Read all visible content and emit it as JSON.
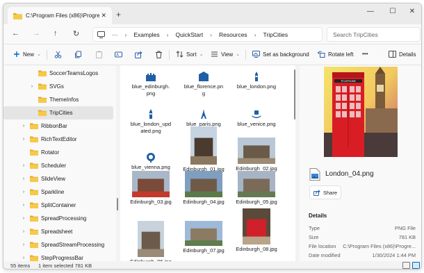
{
  "window": {
    "tab_title": "C:\\Program Files (x86)\\Progres",
    "tab_close": "✕",
    "new_tab": "+",
    "controls": {
      "minimize": "—",
      "maximize": "☐",
      "close": "✕"
    }
  },
  "address": {
    "back": "←",
    "forward": "→",
    "up": "↑",
    "refresh": "↻",
    "overflow": "···",
    "crumbs": [
      "Examples",
      "QuickStart",
      "Resources",
      "TripCities"
    ],
    "separator": "›",
    "search_placeholder": "Search TripCities"
  },
  "commands": {
    "new": "New",
    "sort": "Sort",
    "view": "View",
    "set_background": "Set as background",
    "rotate_left": "Rotate left",
    "more": "•••",
    "details": "Details"
  },
  "tree": [
    {
      "label": "SoccerTeamsLogos",
      "arrow": ""
    },
    {
      "label": "SVGs",
      "arrow": "›"
    },
    {
      "label": "ThemeInfos",
      "arrow": ""
    },
    {
      "label": "TripCities",
      "arrow": "",
      "selected": true
    },
    {
      "label": "RibbonBar",
      "arrow": "›"
    },
    {
      "label": "RichTextEditor",
      "arrow": "›"
    },
    {
      "label": "Rotator",
      "arrow": ""
    },
    {
      "label": "Scheduler",
      "arrow": "›"
    },
    {
      "label": "SlideView",
      "arrow": "›"
    },
    {
      "label": "Sparkline",
      "arrow": "›"
    },
    {
      "label": "SplitContainer",
      "arrow": "›"
    },
    {
      "label": "SpreadProcessing",
      "arrow": "›"
    },
    {
      "label": "Spreadsheet",
      "arrow": "›"
    },
    {
      "label": "SpreadStreamProcessing",
      "arrow": "›"
    },
    {
      "label": "StepProgressBar",
      "arrow": "›"
    }
  ],
  "files": [
    {
      "name1": "blue_edinburgh.",
      "name2": "png",
      "kind": "castle-icon"
    },
    {
      "name1": "blue_florence.pn",
      "name2": "g",
      "kind": "dome-icon"
    },
    {
      "name1": "blue_london.png",
      "name2": "",
      "kind": "bigben-icon"
    },
    {
      "name1": "blue_london_upd",
      "name2": "ated.png",
      "kind": "bigben-icon"
    },
    {
      "name1": "blue_paris.png",
      "name2": "",
      "kind": "eiffel-icon"
    },
    {
      "name1": "blue_venice.png",
      "name2": "",
      "kind": "gondola-icon"
    },
    {
      "name1": "blue_vienna.png",
      "name2": "",
      "kind": "ferris-wheel-icon"
    },
    {
      "name1": "Edinburgh_01.jpg",
      "name2": "",
      "kind": "photo"
    },
    {
      "name1": "Edinburgh_02.jpg",
      "name2": "",
      "kind": "photo"
    },
    {
      "name1": "Edinburgh_03.jpg",
      "name2": "",
      "kind": "photo"
    },
    {
      "name1": "Edinburgh_04.jpg",
      "name2": "",
      "kind": "photo"
    },
    {
      "name1": "Edinburgh_05.jpg",
      "name2": "",
      "kind": "photo"
    },
    {
      "name1": "Edinburgh_06.jpg",
      "name2": "",
      "kind": "photo"
    },
    {
      "name1": "Edinburgh_07.jpg",
      "name2": "",
      "kind": "photo"
    },
    {
      "name1": "Edinburgh_08.jpg",
      "name2": "",
      "kind": "photo"
    }
  ],
  "preview": {
    "file_name": "London_04.png",
    "share": "Share",
    "details_heading": "Details",
    "rows": [
      {
        "k": "Type",
        "v": "PNG File"
      },
      {
        "k": "Size",
        "v": "781 KB"
      },
      {
        "k": "File location",
        "v": "C:\\Program Files (x86)\\Progre..."
      },
      {
        "k": "Date modified",
        "v": "1/30/2024 1:44 PM"
      }
    ]
  },
  "status": {
    "item_count": "55 items",
    "selection": "1 item selected  781 KB"
  },
  "colors": {
    "accent": "#0067c0",
    "folder": "#f7c948",
    "folder_dark": "#e0a82e",
    "selected": "#e5e5e5",
    "icon_blue": "#1f5fa6"
  }
}
